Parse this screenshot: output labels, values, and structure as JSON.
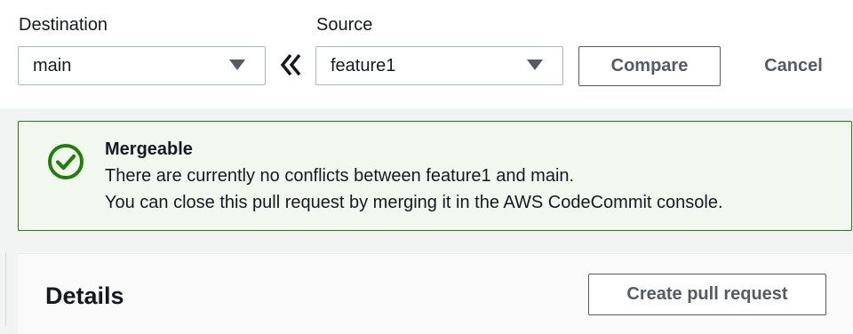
{
  "compare": {
    "destination_label": "Destination",
    "destination_value": "main",
    "source_label": "Source",
    "source_value": "feature1",
    "swap_icon": "double-chevron-left-icon",
    "compare_button": "Compare",
    "cancel_button": "Cancel"
  },
  "alert": {
    "status": "success",
    "icon": "check-circle-icon",
    "title": "Mergeable",
    "line1": "There are currently no conflicts between feature1 and main.",
    "line2": "You can close this pull request by merging it in the AWS CodeCommit console."
  },
  "details": {
    "title": "Details",
    "create_button": "Create pull request"
  },
  "colors": {
    "success_green": "#1d8102",
    "success_bg": "#f2f8f0",
    "button_text": "#545b64",
    "border": "#aab7b8"
  }
}
